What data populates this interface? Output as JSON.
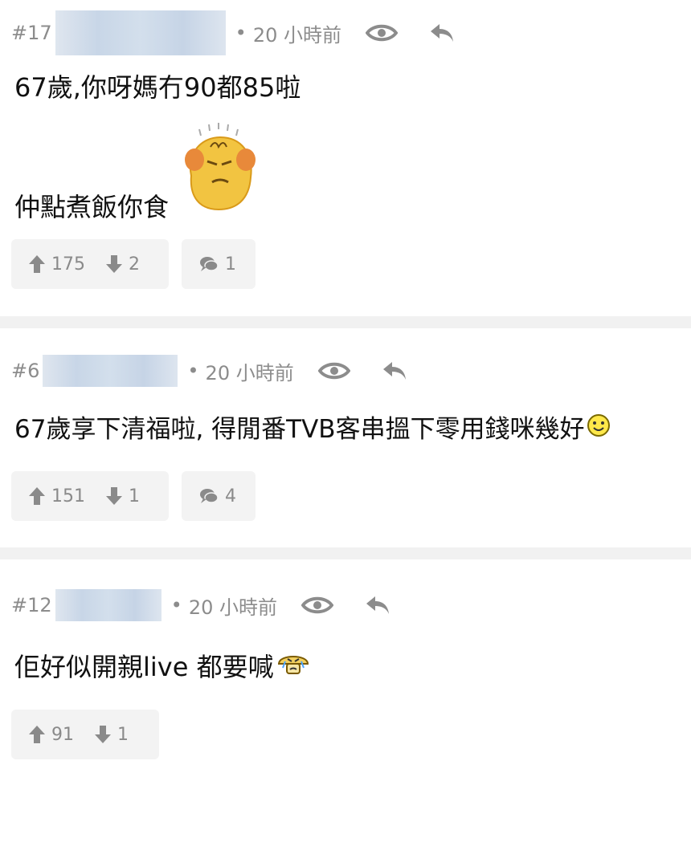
{
  "posts": [
    {
      "number": "#17",
      "separator": "•",
      "time": "20 小時前",
      "lines": [
        "67歲,你呀媽冇90都85啦",
        "仲點煮飯你食"
      ],
      "emoji": "frustrated-face",
      "upvotes": "175",
      "downvotes": "2",
      "replies": "1"
    },
    {
      "number": "#6",
      "separator": "•",
      "time": "20 小時前",
      "lines": [
        "67歲享下清福啦, 得閒番TVB客串搵下零用錢咪幾好"
      ],
      "emoji": "smiley",
      "upvotes": "151",
      "downvotes": "1",
      "replies": "4"
    },
    {
      "number": "#12",
      "separator": "•",
      "time": "20 小時前",
      "lines": [
        "佢好似開親live 都要喊"
      ],
      "emoji": "crying-mushroom",
      "upvotes": "91",
      "downvotes": "1"
    }
  ],
  "colors": {
    "meta": "#8c8c8c",
    "box": "#f3f3f3",
    "divider": "#f1f1f1"
  }
}
